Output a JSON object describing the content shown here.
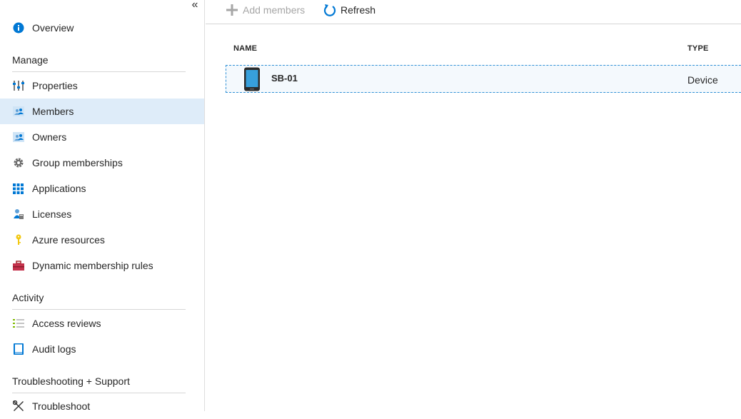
{
  "sidebar": {
    "collapse_glyph": "«",
    "overview": "Overview",
    "sections": {
      "manage": "Manage",
      "activity": "Activity",
      "troubleshooting": "Troubleshooting + Support"
    },
    "items": {
      "properties": "Properties",
      "members": "Members",
      "owners": "Owners",
      "group_memberships": "Group memberships",
      "applications": "Applications",
      "licenses": "Licenses",
      "azure_resources": "Azure resources",
      "dynamic_membership_rules": "Dynamic membership rules",
      "access_reviews": "Access reviews",
      "audit_logs": "Audit logs",
      "troubleshoot": "Troubleshoot"
    },
    "active": "members"
  },
  "toolbar": {
    "add_members": "Add members",
    "refresh": "Refresh"
  },
  "table": {
    "headers": {
      "name": "NAME",
      "type": "TYPE"
    },
    "rows": [
      {
        "name": "SB-01",
        "type": "Device",
        "icon": "phone-device-icon"
      }
    ]
  },
  "colors": {
    "accent": "#0078d4",
    "active_bg": "#deecf9",
    "selection_border": "#2d8fd5"
  }
}
